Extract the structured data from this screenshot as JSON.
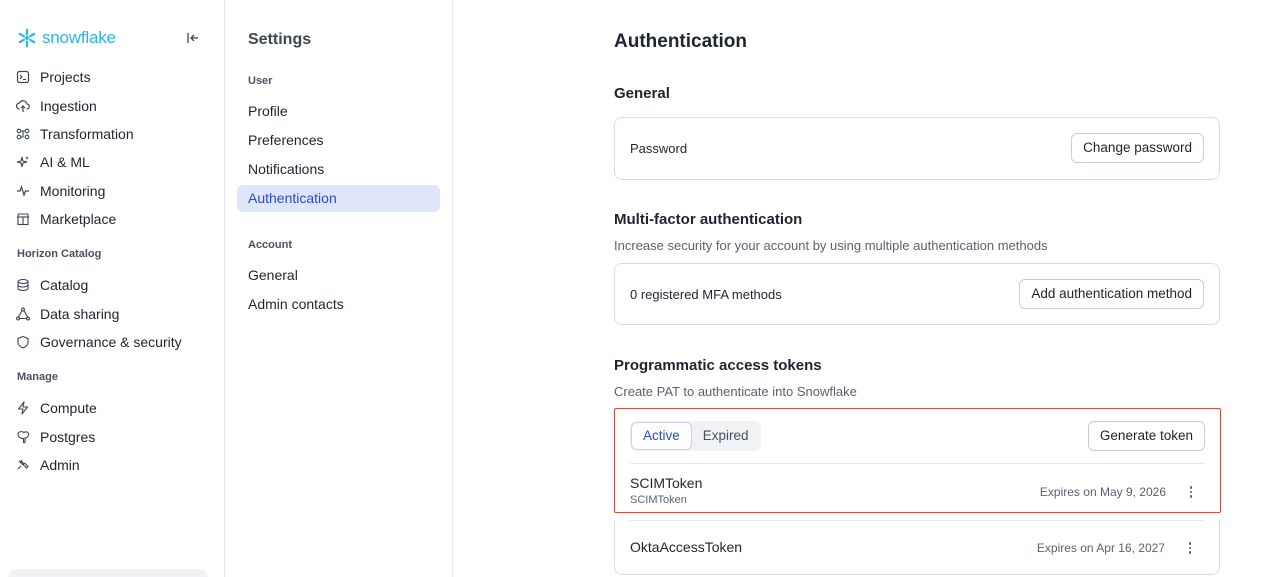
{
  "brand": {
    "name": "snowflake",
    "color": "#29b5e8"
  },
  "nav": {
    "items": [
      {
        "label": "Projects",
        "icon": "projects-icon"
      },
      {
        "label": "Ingestion",
        "icon": "ingestion-icon"
      },
      {
        "label": "Transformation",
        "icon": "transformation-icon"
      },
      {
        "label": "AI & ML",
        "icon": "sparkle-icon"
      },
      {
        "label": "Monitoring",
        "icon": "pulse-icon"
      },
      {
        "label": "Marketplace",
        "icon": "marketplace-icon"
      }
    ],
    "section_horizon": "Horizon Catalog",
    "horizon_items": [
      {
        "label": "Catalog",
        "icon": "database-icon"
      },
      {
        "label": "Data sharing",
        "icon": "share-icon"
      },
      {
        "label": "Governance & security",
        "icon": "shield-icon"
      }
    ],
    "section_manage": "Manage",
    "manage_items": [
      {
        "label": "Compute",
        "icon": "bolt-icon"
      },
      {
        "label": "Postgres",
        "icon": "postgres-icon"
      },
      {
        "label": "Admin",
        "icon": "admin-icon"
      }
    ]
  },
  "settings": {
    "title": "Settings",
    "section_user": "User",
    "user_items": [
      "Profile",
      "Preferences",
      "Notifications",
      "Authentication"
    ],
    "active_item": "Authentication",
    "section_account": "Account",
    "account_items": [
      "General",
      "Admin contacts"
    ]
  },
  "main": {
    "title": "Authentication",
    "general": {
      "heading": "General",
      "password_label": "Password",
      "change_password_button": "Change password"
    },
    "mfa": {
      "heading": "Multi-factor authentication",
      "description": "Increase security for your account by using multiple authentication methods",
      "count_label": "0 registered MFA methods",
      "add_button": "Add authentication method"
    },
    "pat": {
      "heading": "Programmatic access tokens",
      "description": "Create PAT to authenticate into Snowflake",
      "tabs": [
        "Active",
        "Expired"
      ],
      "active_tab": "Active",
      "generate_button": "Generate token",
      "tokens": [
        {
          "name": "SCIMToken",
          "subtitle": "SCIMToken",
          "expires": "Expires on May 9, 2026"
        },
        {
          "name": "OktaAccessToken",
          "subtitle": "",
          "expires": "Expires on Apr 16, 2027"
        }
      ]
    }
  },
  "colors": {
    "accent": "#2b4bc9",
    "active_bg": "#dfe5fb",
    "highlight_border": "#d84a3a"
  }
}
